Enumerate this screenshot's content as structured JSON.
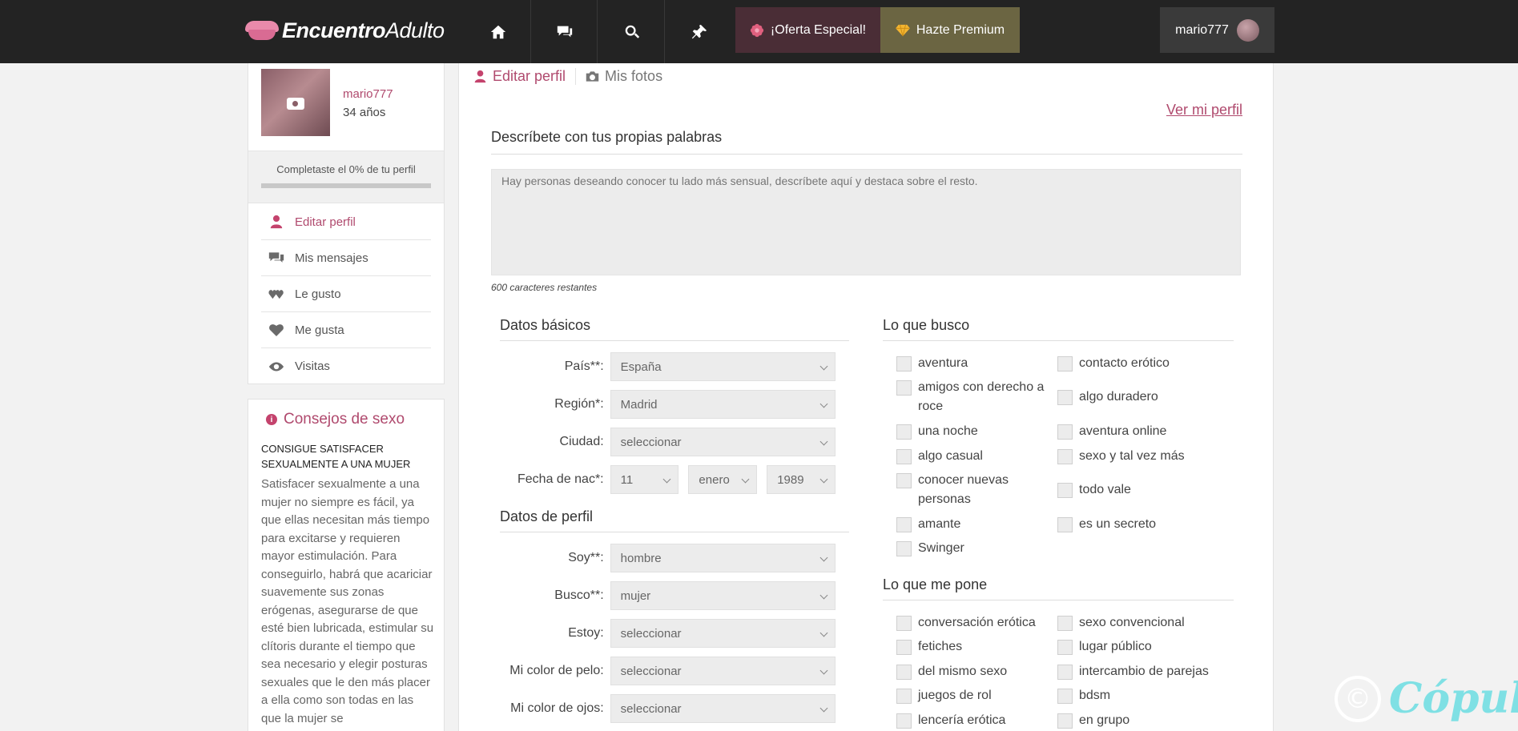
{
  "header": {
    "logo_bold": "Encuentro",
    "logo_light": "Adulto",
    "nav_icons": [
      "home-icon",
      "messages-icon",
      "search-icon",
      "pin-icon"
    ],
    "offer_label": "¡Oferta Especial!",
    "premium_label": "Hazte Premium",
    "username": "mario777"
  },
  "sidebar": {
    "name": "mario777",
    "age": "34 años",
    "progress_text": "Completaste el 0% de tu perfil",
    "progress_percent": 0,
    "menu": [
      {
        "label": "Editar perfil",
        "icon": "user-icon"
      },
      {
        "label": "Mis mensajes",
        "icon": "messages-icon"
      },
      {
        "label": "Le gusto",
        "icon": "hearts-icon"
      },
      {
        "label": "Me gusta",
        "icon": "heart-icon"
      },
      {
        "label": "Visitas",
        "icon": "eye-icon"
      }
    ],
    "tips": {
      "title": "Consejos de sexo",
      "heading": "CONSIGUE SATISFACER SEXUALMENTE A UNA MUJER",
      "body": "Satisfacer sexualmente a una mujer no siempre es fácil, ya que ellas necesitan más tiempo para excitarse y requieren mayor estimulación. Para conseguirlo, habrá que acariciar suavemente sus zonas erógenas, asegurarse de que esté bien lubricada, estimular su clítoris durante el tiempo que sea necesario y elegir posturas sexuales que le den más placer a ella como son todas en las que la mujer se"
    }
  },
  "main": {
    "tab_edit": "Editar perfil",
    "tab_photos": "Mis fotos",
    "view_profile": "Ver mi perfil",
    "desc_title": "Descríbete con tus propias palabras",
    "desc_placeholder": "Hay personas deseando conocer tu lado más sensual, descríbete aquí y destaca sobre el resto.",
    "chars_left": "600 caracteres restantes",
    "basic_title": "Datos básicos",
    "basic": {
      "pais_label": "País**:",
      "pais_value": "España",
      "region_label": "Región*:",
      "region_value": "Madrid",
      "ciudad_label": "Ciudad:",
      "ciudad_value": "seleccionar",
      "fecha_label": "Fecha de nac*:",
      "dia": "11",
      "mes": "enero",
      "anio": "1989"
    },
    "profile_title": "Datos de perfil",
    "profile": {
      "soy_label": "Soy**:",
      "soy_value": "hombre",
      "busco_label": "Busco**:",
      "busco_value": "mujer",
      "estoy_label": "Estoy:",
      "estoy_value": "seleccionar",
      "pelo_label": "Mi color de pelo:",
      "pelo_value": "seleccionar",
      "ojos_label": "Mi color de ojos:",
      "ojos_value": "seleccionar"
    },
    "looking_title": "Lo que busco",
    "looking_left": [
      "aventura",
      "amigos con derecho a roce",
      "una noche",
      "algo casual",
      "conocer nuevas personas",
      "amante",
      "Swinger"
    ],
    "looking_right": [
      "contacto erótico",
      "algo duradero",
      "aventura online",
      "sexo y tal vez más",
      "todo vale",
      "es un secreto"
    ],
    "turnon_title": "Lo que me pone",
    "turnon_left": [
      "conversación erótica",
      "fetiches",
      "del mismo sexo",
      "juegos de rol",
      "lencería erótica"
    ],
    "turnon_right": [
      "sexo convencional",
      "lugar público",
      "intercambio de parejas",
      "bdsm",
      "en grupo"
    ]
  },
  "watermark": {
    "symbol": "©",
    "text": "Cópuli"
  },
  "colors": {
    "accent": "#b04a6e",
    "topbar": "#232323",
    "offer_bg": "#4a2d36",
    "premium_bg": "#6b6542",
    "watermark": "#7fe0e4"
  }
}
